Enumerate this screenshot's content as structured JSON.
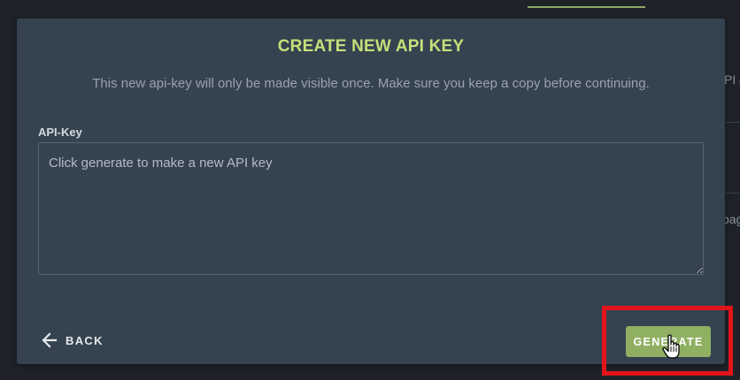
{
  "background": {
    "right_text_1": "PI c",
    "right_text_2": "pag"
  },
  "modal": {
    "title": "CREATE NEW API KEY",
    "description": "This new api-key will only be made visible once. Make sure you keep a copy before continuing.",
    "field_label": "API-Key",
    "field_value": "",
    "field_placeholder": "Click generate to make a new API key",
    "back_label": "BACK",
    "generate_label": "GENERATE"
  },
  "colors": {
    "title_accent": "#c3e07a",
    "primary_button": "#8fb063",
    "highlight": "#e3141b",
    "modal_bg": "#354250"
  },
  "icons": {
    "back": "arrow-left-icon",
    "cursor": "hand-pointer-icon"
  }
}
